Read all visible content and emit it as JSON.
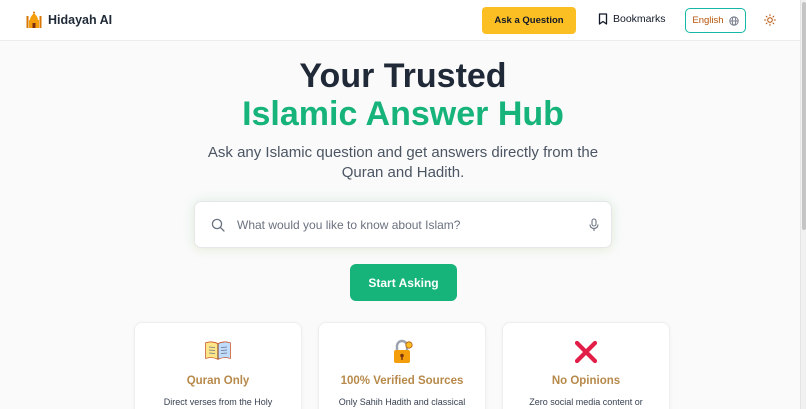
{
  "header": {
    "brand": "Hidayah AI",
    "ask_button": "Ask a Question",
    "bookmarks": "Bookmarks",
    "language": "English",
    "logo_icon": "mosque-icon",
    "theme_icon": "sun-icon"
  },
  "hero": {
    "title_line1": "Your Trusted",
    "title_line2": "Islamic Answer Hub",
    "subtitle": "Ask any Islamic question and get answers directly from the Quran and Hadith."
  },
  "search": {
    "placeholder": "What would you like to know about Islam?",
    "value": ""
  },
  "start_button": "Start Asking",
  "features": [
    {
      "icon": "open-book-icon",
      "title": "Quran Only",
      "description": "Direct verses from the Holy"
    },
    {
      "icon": "lock-icon",
      "title": "100% Verified Sources",
      "description": "Only Sahih Hadith and classical"
    },
    {
      "icon": "cross-mark-icon",
      "title": "No Opinions",
      "description": "Zero social media content or"
    }
  ],
  "colors": {
    "accent_green": "#16b37b",
    "accent_yellow": "#fbbf24",
    "teal_border": "#14b8a6",
    "card_title": "#b7894a"
  }
}
